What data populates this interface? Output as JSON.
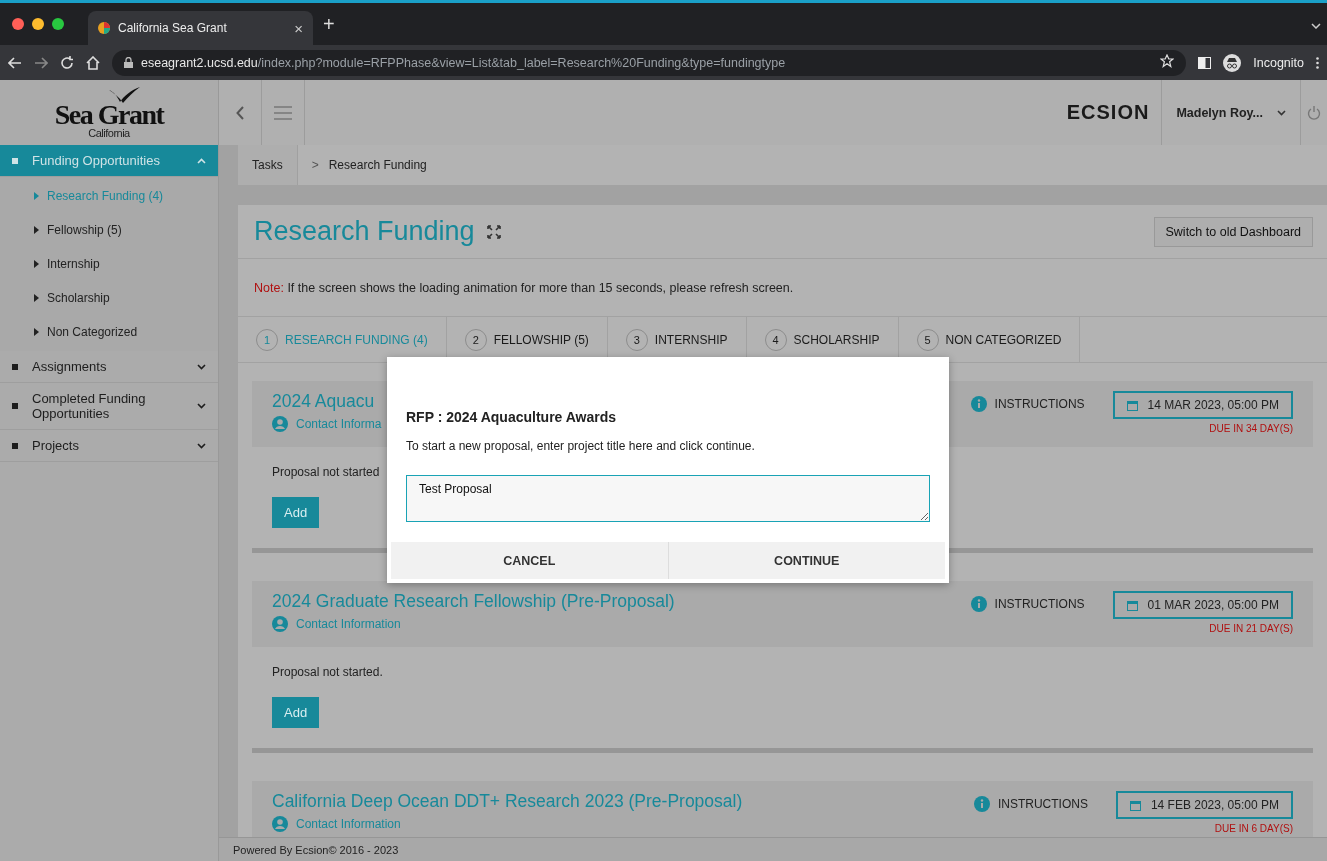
{
  "browser": {
    "tab_title": "California Sea Grant",
    "tab_close": "×",
    "new_tab": "+",
    "url_host": "eseagrant2.ucsd.edu",
    "url_path": "/index.php?module=RFPPhase&view=List&tab_label=Research%20Funding&type=fundingtype",
    "incognito": "Incognito"
  },
  "header": {
    "logo_title": "Sea Grant",
    "logo_subtitle": "California",
    "brand": "ECSION",
    "user": "Madelyn Roy..."
  },
  "sidebar": {
    "items": [
      {
        "label": "Funding Opportunities",
        "selected": true,
        "expanded": true,
        "children": [
          {
            "label": "Research Funding",
            "count": "(4)",
            "selected": true
          },
          {
            "label": "Fellowship",
            "count": "(5)",
            "selected": false
          },
          {
            "label": "Internship",
            "selected": false
          },
          {
            "label": "Scholarship",
            "selected": false
          },
          {
            "label": "Non Categorized",
            "selected": false
          }
        ]
      },
      {
        "label": "Assignments",
        "selected": false,
        "expanded": false
      },
      {
        "label": "Completed Funding Opportunities",
        "selected": false,
        "expanded": false
      },
      {
        "label": "Projects",
        "selected": false,
        "expanded": false
      }
    ]
  },
  "breadcrumb": [
    "Tasks",
    "Research Funding"
  ],
  "breadcrumb_separator": ">",
  "page": {
    "title": "Research Funding",
    "switch_button": "Switch to old Dashboard",
    "note_label": "Note:",
    "note_text": "If the screen shows the loading animation for more than 15 seconds, please refresh screen."
  },
  "tabs": [
    {
      "number": "1",
      "label": "RESEARCH FUNDING (4)",
      "selected": true
    },
    {
      "number": "2",
      "label": "FELLOWSHIP (5)",
      "selected": false
    },
    {
      "number": "3",
      "label": "INTERNSHIP",
      "selected": false
    },
    {
      "number": "4",
      "label": "SCHOLARSHIP",
      "selected": false
    },
    {
      "number": "5",
      "label": "NON CATEGORIZED",
      "selected": false
    }
  ],
  "cards": [
    {
      "title": "2024 Aquacu",
      "contact": "Contact Informa",
      "instructions": "INSTRUCTIONS",
      "date": "14 MAR 2023, 05:00 PM",
      "due": "DUE IN 34 DAY(S)",
      "status": "Proposal not started",
      "add": "Add"
    },
    {
      "title": "2024 Graduate Research Fellowship (Pre-Proposal)",
      "contact": "Contact Information",
      "instructions": "INSTRUCTIONS",
      "date": "01 MAR 2023, 05:00 PM",
      "due": "DUE IN 21 DAY(S)",
      "status": "Proposal not started.",
      "add": "Add"
    },
    {
      "title": "California Deep Ocean DDT+ Research 2023 (Pre-Proposal)",
      "contact": "Contact Information",
      "instructions": "INSTRUCTIONS",
      "date": "14 FEB 2023, 05:00 PM",
      "due": "DUE IN 6 DAY(S)"
    }
  ],
  "modal": {
    "title": "RFP : 2024 Aquaculture Awards",
    "text": "To start a new proposal, enter project title here and click continue.",
    "value": "Test Proposal",
    "buttons": [
      "CANCEL",
      "CONTINUE"
    ]
  },
  "footer": "Powered By Ecsion© 2016 - 2023"
}
